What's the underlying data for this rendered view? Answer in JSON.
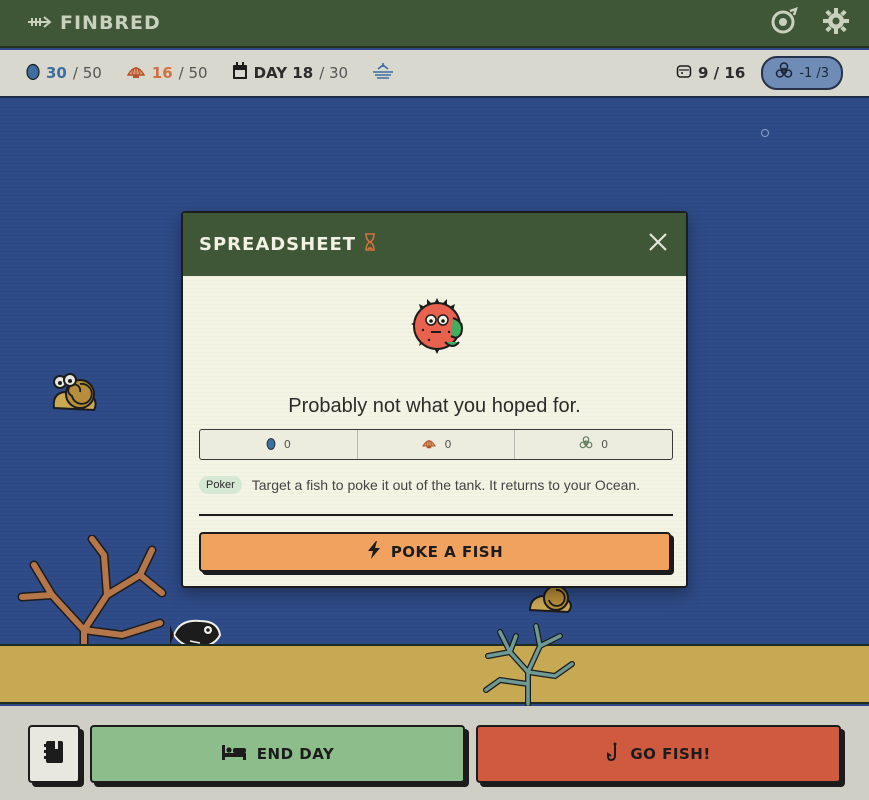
{
  "app": {
    "title": "FINBRED"
  },
  "status": {
    "eggs": {
      "current": "30",
      "max": "/ 50"
    },
    "shells": {
      "current": "16",
      "max": "/ 50"
    },
    "day": {
      "label": "DAY 18",
      "max": "/ 30"
    },
    "tank": {
      "count": "9 / 16"
    },
    "biohazard": {
      "value": "-1 /3"
    }
  },
  "modal": {
    "title": "SPREADSHEET",
    "headline": "Probably not what you hoped for.",
    "stats": {
      "eggs": "0",
      "shells": "0",
      "biohazard": "0"
    },
    "ability_tag": "Poker",
    "ability_text": "Target a fish to poke it out of the tank. It returns to your Ocean.",
    "action_label": "POKE A FISH"
  },
  "bottom": {
    "end_day_label": "END DAY",
    "go_fish_label": "GO FISH!"
  },
  "icons": [
    "fish-skeleton-icon",
    "ocean-view-icon",
    "gear-icon",
    "egg-icon",
    "shell-icon",
    "calendar-icon",
    "water-level-icon",
    "tank-icon",
    "biohazard-icon",
    "hourglass-icon",
    "close-icon",
    "lightning-icon",
    "book-icon",
    "bed-icon",
    "fish-hook-icon"
  ],
  "colors": {
    "header": "#3f5637",
    "ocean": "#2e4a86",
    "sand": "#c8a953",
    "poke": "#f1a25e",
    "end_day": "#8cbd8b",
    "go_fish": "#cf5a3f"
  }
}
